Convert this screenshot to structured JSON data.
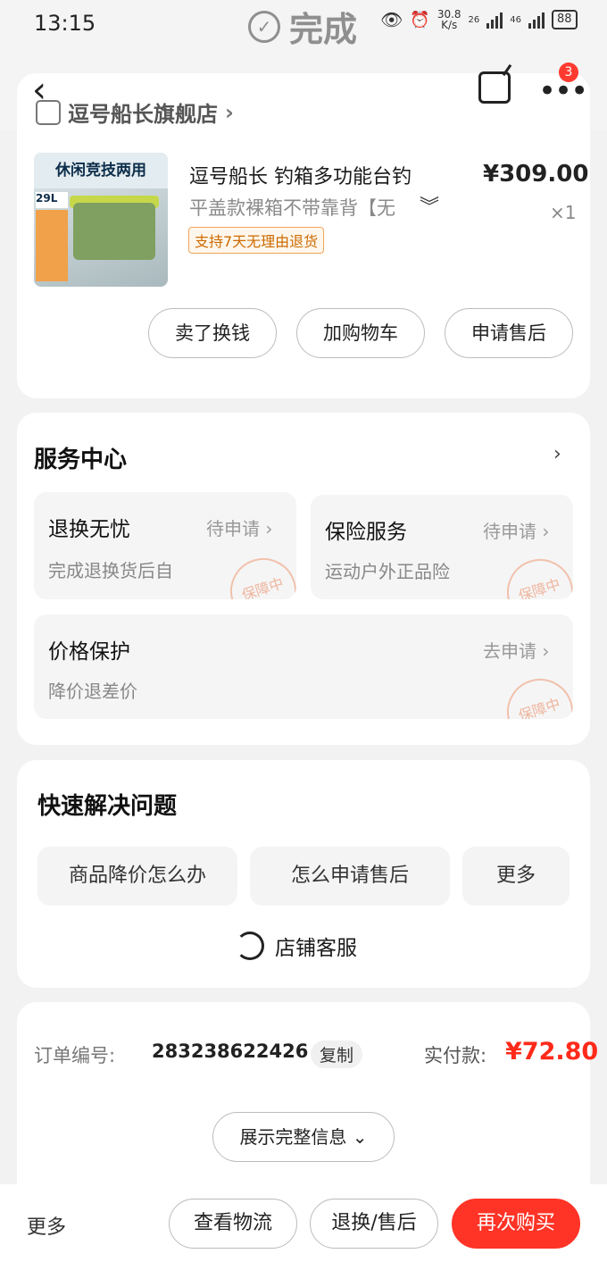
{
  "status_bar": {
    "time": "13:15",
    "center_label": "完成",
    "net_speed": "30.8",
    "net_speed_unit": "K/s",
    "sig1": "26",
    "sig2": "46",
    "battery": "88"
  },
  "header": {
    "badge_count": "3",
    "shop_name": "逗号船长旗舰店"
  },
  "product": {
    "image_banner": "休闲竞技两用",
    "image_tag": "29L",
    "title": "逗号船长 钓箱多功能台钓",
    "variant": "平盖款裸箱不带靠背【无",
    "return_tag": "支持7天无理由退货",
    "price": "¥309.00",
    "quantity": "×1",
    "buttons": [
      "卖了换钱",
      "加购物车",
      "申请售后"
    ]
  },
  "service_center": {
    "title": "服务中心",
    "items": [
      {
        "name": "退换无忧",
        "status": "待申请",
        "desc": "完成退换货后自",
        "stamp": "保障中"
      },
      {
        "name": "保险服务",
        "status": "待申请",
        "desc": "运动户外正品险",
        "stamp": "保障中"
      },
      {
        "name": "价格保护",
        "status": "去申请",
        "desc": "降价退差价",
        "stamp": "保障中"
      }
    ]
  },
  "quick_solve": {
    "title": "快速解决问题",
    "buttons": [
      "商品降价怎么办",
      "怎么申请售后",
      "更多"
    ],
    "customer_service": "店铺客服"
  },
  "order": {
    "number_label": "订单编号:",
    "number": "283238622426",
    "copy_label": "复制",
    "paid_label": "实付款:",
    "paid_amount": "¥72.80",
    "show_more": "展示完整信息"
  },
  "bottom_bar": {
    "more": "更多",
    "logistics": "查看物流",
    "after_sale": "退换/售后",
    "buy_again": "再次购买"
  },
  "colors": {
    "accent": "#ff3326",
    "price_red": "#ff2a1a",
    "tag_orange": "#cc6a00"
  }
}
